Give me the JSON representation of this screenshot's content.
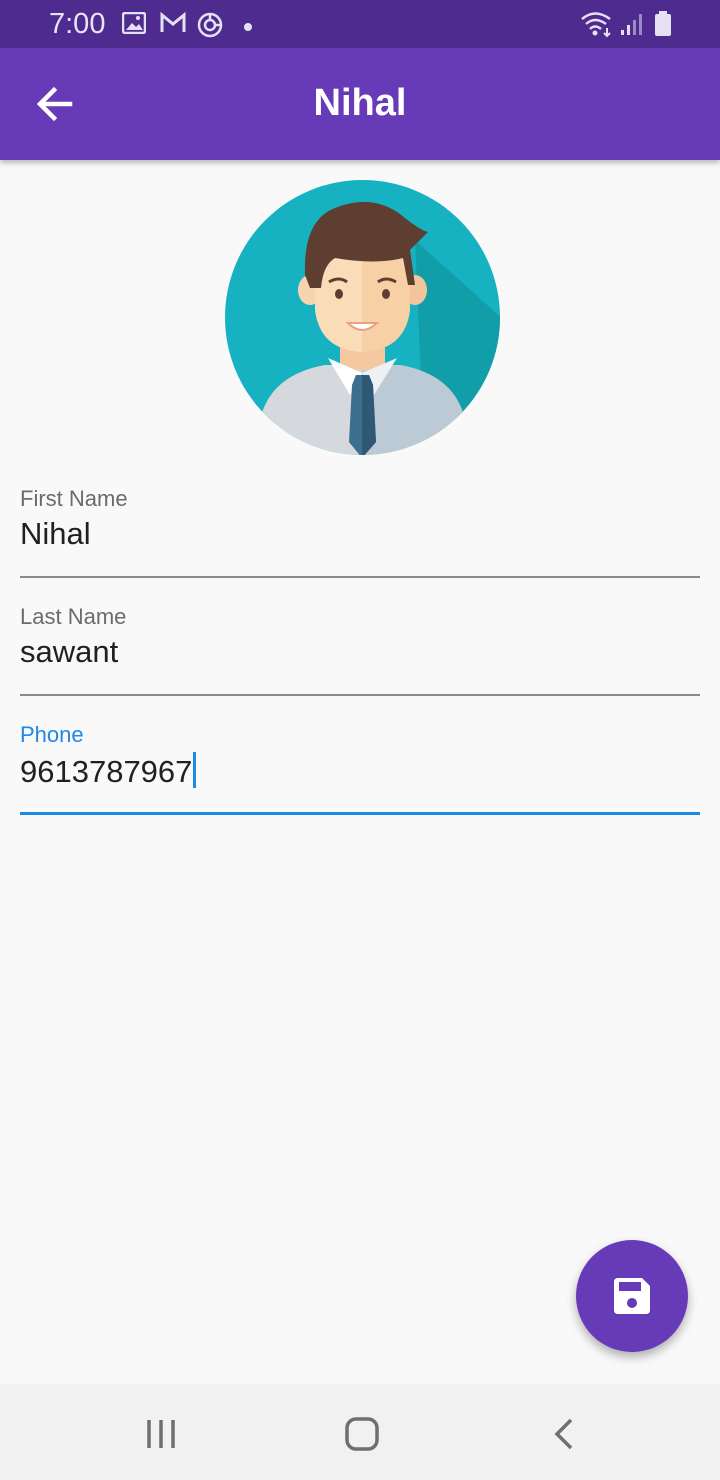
{
  "status_bar": {
    "time": "7:00",
    "left_icons": [
      "image-icon",
      "gmail-icon",
      "sync-icon",
      "dot-icon"
    ],
    "right_icons": [
      "wifi-icon",
      "signal-icon",
      "battery-icon"
    ]
  },
  "app_bar": {
    "title": "Nihal",
    "back_icon": "arrow-back-icon",
    "color": "#673ab7"
  },
  "profile": {
    "avatar_icon": "person-avatar-icon"
  },
  "form": {
    "first_name": {
      "label": "First Name",
      "value": "Nihal"
    },
    "last_name": {
      "label": "Last Name",
      "value": "sawant"
    },
    "phone": {
      "label": "Phone",
      "value": "9613787967",
      "focused": true
    }
  },
  "fab": {
    "icon": "save-icon",
    "color": "#673ab7"
  },
  "nav_bar": {
    "icons": [
      "recents-icon",
      "home-icon",
      "back-icon"
    ]
  },
  "colors": {
    "status_bar": "#4e2c8f",
    "accent_focus": "#1e88e5",
    "background": "#f9f9f9"
  }
}
